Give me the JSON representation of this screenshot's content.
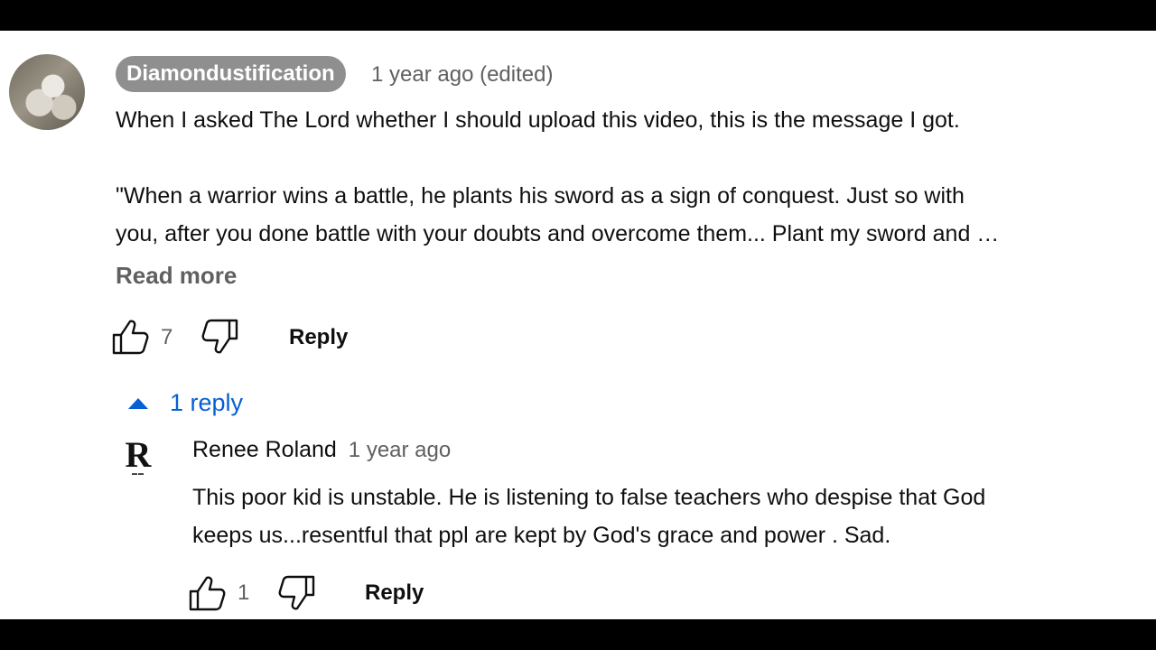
{
  "comment": {
    "author": "Diamondustification",
    "timestamp": "1 year ago (edited)",
    "lines": [
      "When I asked The Lord whether I should upload this video, this is the message I got.",
      "",
      "\"When a warrior wins a battle, he plants his sword as a sign of conquest. Just so with",
      "you, after you done battle with your doubts and overcome them... Plant my sword and …"
    ],
    "read_more": "Read more",
    "likes": "7",
    "reply_label": "Reply"
  },
  "replies_toggle": {
    "label": "1 reply",
    "icon": "caret-up-icon",
    "color": "#065fd4"
  },
  "reply": {
    "author": "Renee Roland",
    "timestamp": "1 year ago",
    "lines": [
      "This poor kid is unstable.  He is listening to false teachers who despise that God",
      "keeps us...resentful that ppl are kept by God's grace and power .  Sad."
    ],
    "avatar_letter": "R",
    "likes": "1",
    "reply_label": "Reply"
  }
}
